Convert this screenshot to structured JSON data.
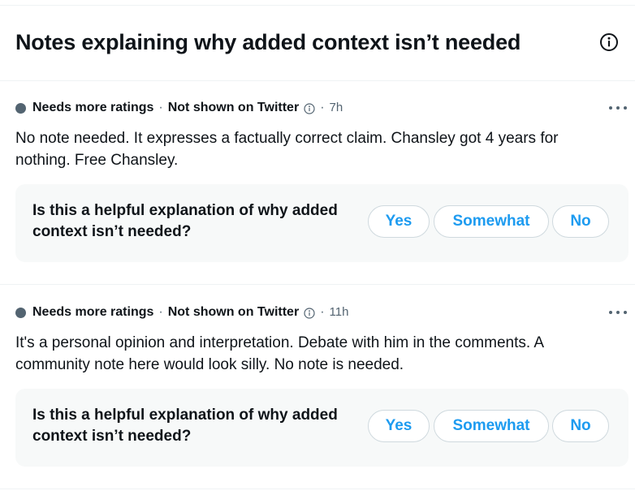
{
  "header": {
    "title": "Notes explaining why added context isn’t needed",
    "info_icon": "info-circle-icon"
  },
  "notes": [
    {
      "status": "Needs more ratings",
      "separator": "·",
      "visibility": "Not shown on Twitter",
      "time_sep": "·",
      "time": "7h",
      "text": "No note needed. It expresses a factually correct claim. Chansley got 4 years for nothing. Free Chansley.",
      "question": "Is this a helpful explanation of why added context isn’t needed?",
      "buttons": {
        "yes": "Yes",
        "somewhat": "Somewhat",
        "no": "No"
      }
    },
    {
      "status": "Needs more ratings",
      "separator": "·",
      "visibility": "Not shown on Twitter",
      "time_sep": "·",
      "time": "11h",
      "text": "It's a personal opinion and interpretation. Debate with him in the comments. A community note here would look silly. No note is needed.",
      "question": "Is this a helpful explanation of why added context isn’t needed?",
      "buttons": {
        "yes": "Yes",
        "somewhat": "Somewhat",
        "no": "No"
      }
    }
  ],
  "colors": {
    "accent": "#1d9bf0",
    "text": "#0f1419",
    "secondary": "#536471",
    "panel": "#f7f9f9",
    "border": "#cfd9de"
  }
}
